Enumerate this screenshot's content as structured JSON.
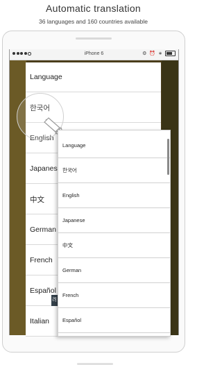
{
  "header": {
    "title": "Automatic translation",
    "subtitle": "36 languages and 160 countries available"
  },
  "statusbar": {
    "device_name": "iPhone 6",
    "icons": [
      "signal-dots-icon",
      "rotation-lock-icon",
      "alarm-icon",
      "bluetooth-icon",
      "battery-icon"
    ]
  },
  "back_list": {
    "items": [
      "Language",
      "한국어",
      "English",
      "Japanese",
      "中文",
      "German",
      "French",
      "Español",
      "Italian"
    ]
  },
  "front_list": {
    "items": [
      "Language",
      "한국어",
      "English",
      "Japanese",
      "中文",
      "German",
      "French",
      "Español"
    ]
  },
  "overlay_tag": "려",
  "colors": {
    "app_background": "#4b3e1b",
    "list_background": "#ffffff",
    "divider": "#d9d9d9"
  }
}
